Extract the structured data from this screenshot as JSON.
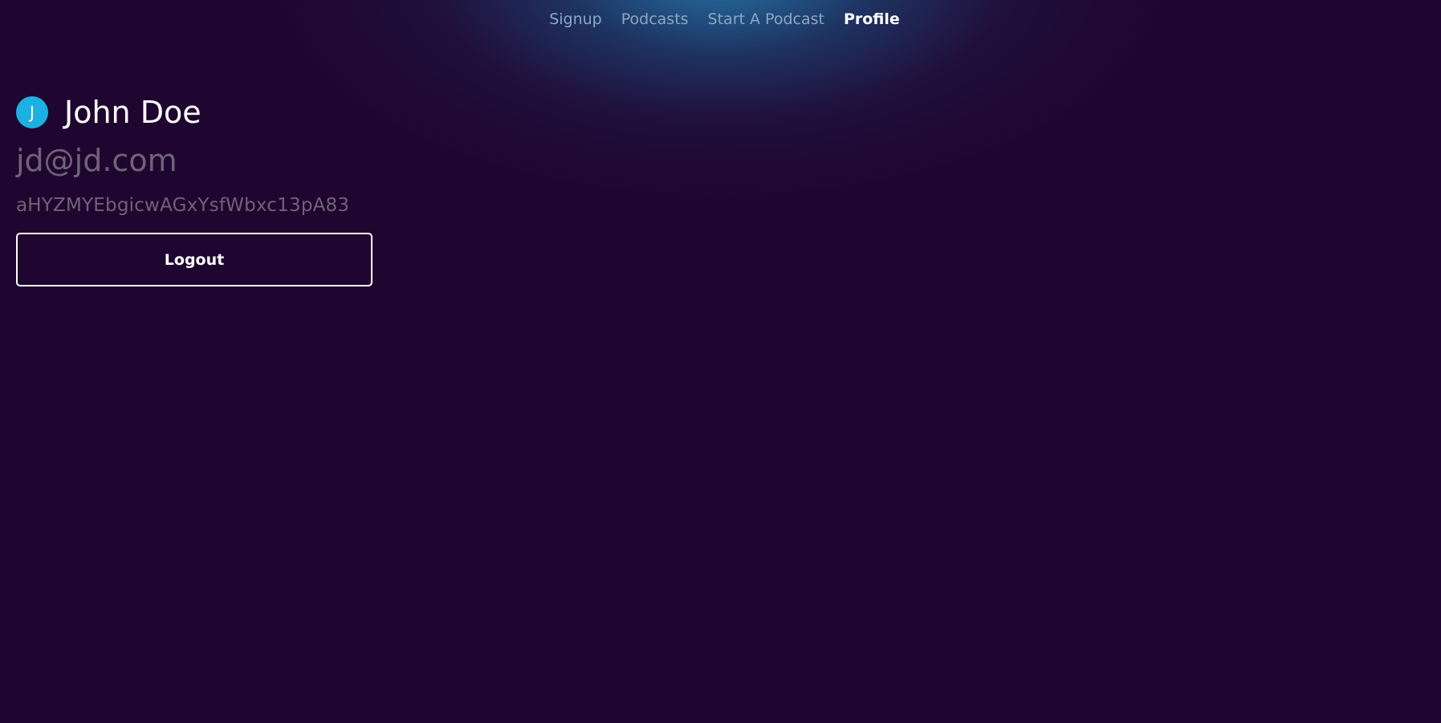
{
  "nav": {
    "items": [
      {
        "label": "Signup"
      },
      {
        "label": "Podcasts"
      },
      {
        "label": "Start A Podcast"
      },
      {
        "label": "Profile"
      }
    ],
    "active": "Profile"
  },
  "profile": {
    "avatar_initial": "J",
    "name": "John Doe",
    "email": "jd@jd.com",
    "token": "aHYZMYEbgicwAGxYsfWbxc13pA83",
    "logout_label": "Logout"
  },
  "colors": {
    "background": "#1f0630",
    "avatar": "#1cb1e2",
    "nav_inactive": "#8da7c4",
    "muted_text": "#6f6377"
  }
}
